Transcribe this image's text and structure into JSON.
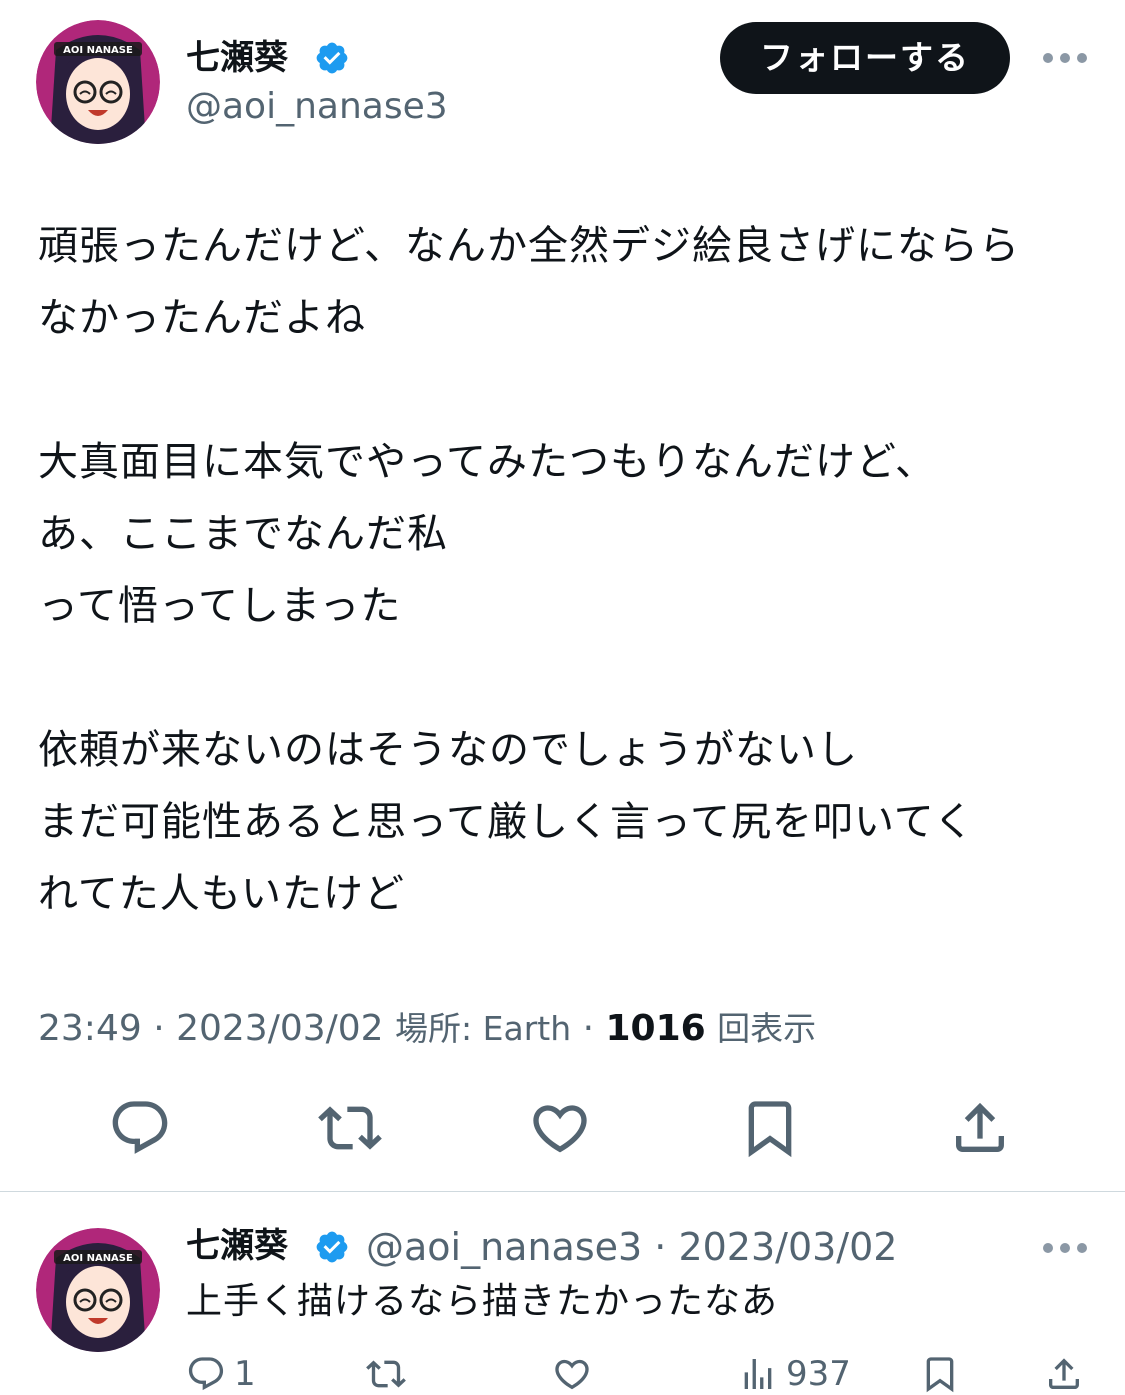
{
  "tweet": {
    "author_name": "七瀬葵",
    "handle": "@aoi_nanase3",
    "avatar_label": "AOI NANASE",
    "follow_label": "フォローする",
    "paragraphs": [
      [
        "頑張ったんだけど、なんか全然デジ絵良さげにならら",
        "なかったんだよね"
      ],
      [
        "大真面目に本気でやってみたつもりなんだけど、",
        "あ、ここまでなんだ私",
        "って悟ってしまった"
      ],
      [
        "依頼が来ないのはそうなのでしょうがないし",
        "まだ可能性あると思って厳しく言って尻を叩いてく",
        "れてた人もいたけど"
      ]
    ],
    "time": "23:49",
    "date": "2023/03/02",
    "location_label": "場所: Earth",
    "view_count": "1016",
    "view_unit": "回表示"
  },
  "reply": {
    "author_name": "七瀬葵",
    "handle": "@aoi_nanase3",
    "date": "2023/03/02",
    "text": "上手く描けるなら描きたかったなあ",
    "reply_count": "1",
    "view_count": "937"
  },
  "colors": {
    "text": "#0f1419",
    "secondary": "#536471",
    "verified": "#1d9bf0",
    "avatar_bg": "#b0277a"
  }
}
